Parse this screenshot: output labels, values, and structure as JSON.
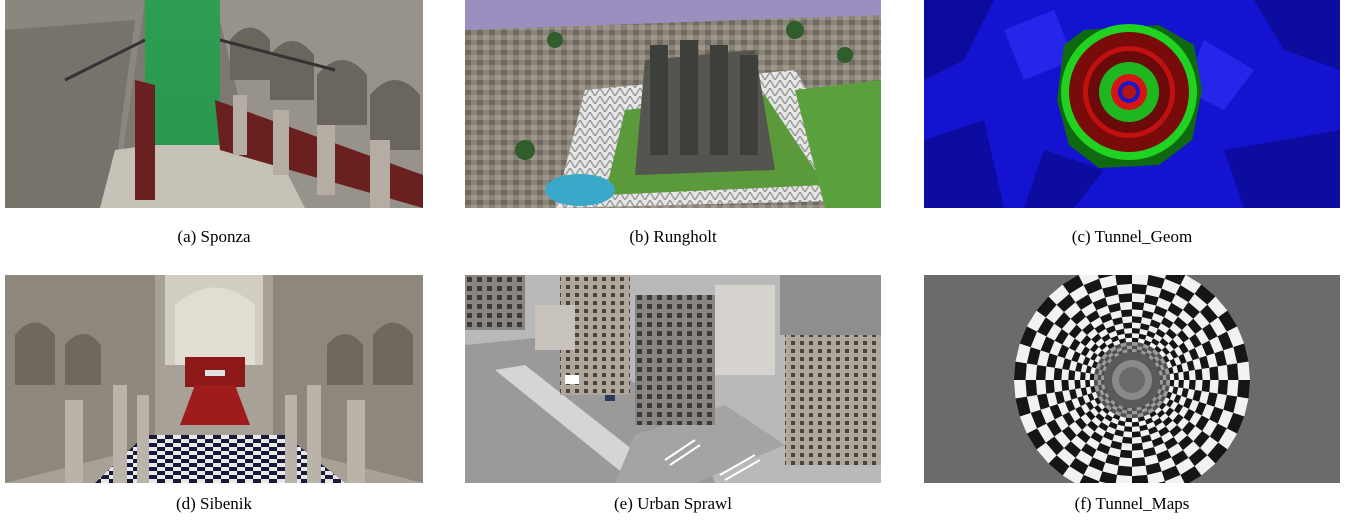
{
  "figure": {
    "panels": [
      {
        "caption": "(a) Sponza",
        "scene": "sponza-atrium-render"
      },
      {
        "caption": "(b) Rungholt",
        "scene": "rungholt-voxel-city-render"
      },
      {
        "caption": "(c) Tunnel_Geom",
        "scene": "tunnel-geometry-heatmap-render"
      },
      {
        "caption": "(d) Sibenik",
        "scene": "sibenik-cathedral-render"
      },
      {
        "caption": "(e) Urban Sprawl",
        "scene": "urban-sprawl-city-render"
      },
      {
        "caption": "(f) Tunnel_Maps",
        "scene": "checkerboard-tunnel-render"
      }
    ]
  }
}
